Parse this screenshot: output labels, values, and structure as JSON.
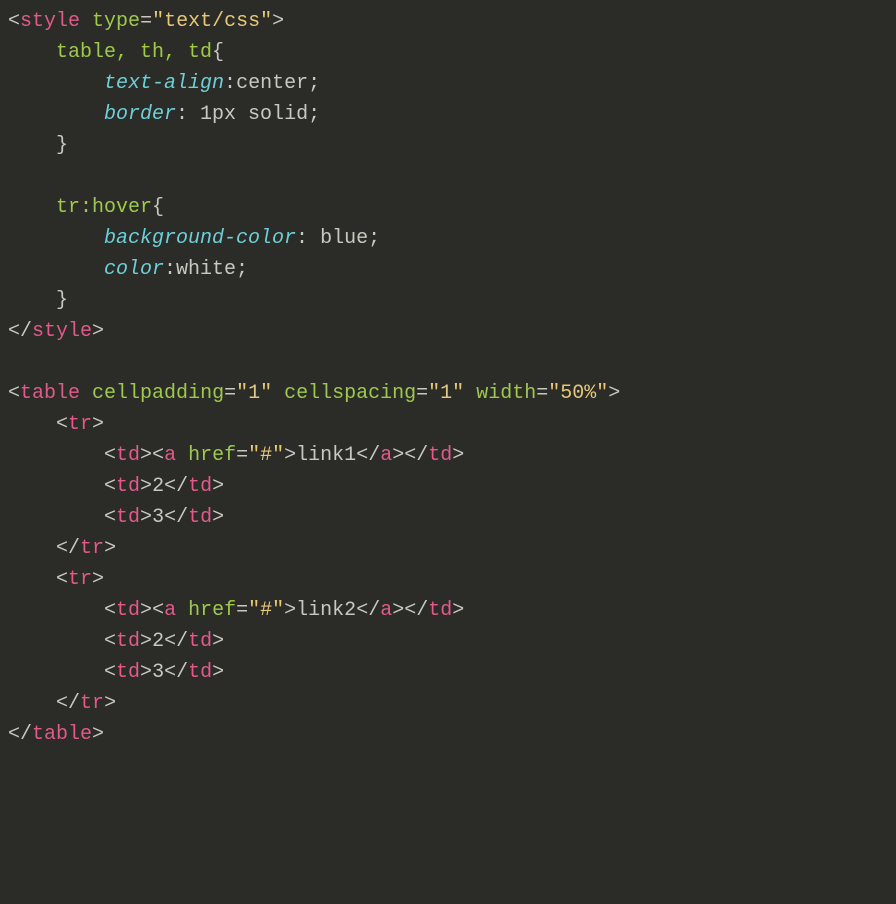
{
  "code": {
    "style": {
      "open1": "<",
      "close": ">",
      "slash": "/",
      "styleTag": "style",
      "typeAttr": "type",
      "typeVal": "\"text/css\"",
      "sel1": "table, th, td",
      "prop_textalign": "text-align",
      "val_center": "center;",
      "prop_border": "border",
      "val_border": " 1px solid;",
      "sel2": "tr:hover",
      "prop_bg": "background-color",
      "val_bg": " blue;",
      "prop_color": "color",
      "val_color": "white;"
    },
    "table": {
      "tableTag": "table",
      "cellpadAttr": "cellpadding",
      "cellpadVal": "\"1\"",
      "cellspAttr": "cellspacing",
      "cellspVal": "\"1\"",
      "widthAttr": "width",
      "widthVal": "\"50%\"",
      "trTag": "tr",
      "tdTag": "td",
      "aTag": "a",
      "hrefAttr": "href",
      "hrefVal": "\"#\"",
      "link1": "link1",
      "link2": "link2",
      "cell2": "2",
      "cell3": "3"
    }
  }
}
